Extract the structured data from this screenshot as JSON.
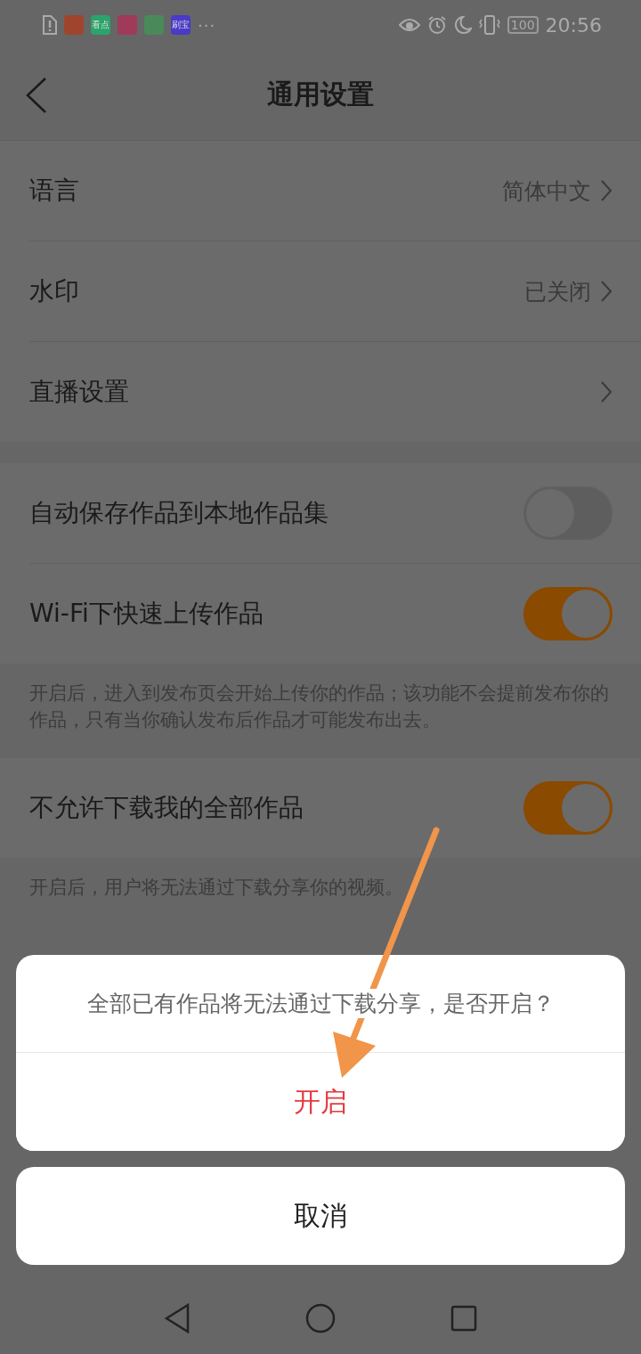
{
  "status_bar": {
    "app_icons": [
      {
        "kind": "warning"
      },
      {
        "kind": "red"
      },
      {
        "kind": "text",
        "label": "看点",
        "color": "#2aa46a"
      },
      {
        "kind": "pink"
      },
      {
        "kind": "green"
      },
      {
        "kind": "text",
        "label": "刷宝",
        "color": "#4a3ac8"
      }
    ],
    "more": "···",
    "battery": "100",
    "time": "20:56"
  },
  "header": {
    "title": "通用设置"
  },
  "sections": [
    {
      "rows": [
        {
          "kind": "link",
          "label": "语言",
          "value": "简体中文"
        },
        {
          "kind": "link",
          "label": "水印",
          "value": "已关闭"
        },
        {
          "kind": "link",
          "label": "直播设置"
        }
      ]
    },
    {
      "rows": [
        {
          "kind": "toggle",
          "label": "自动保存作品到本地作品集",
          "on": false
        },
        {
          "kind": "toggle",
          "label": "Wi-Fi下快速上传作品",
          "on": true
        }
      ],
      "note": "开启后，进入到发布页会开始上传你的作品；该功能不会提前发布你的作品，只有当你确认发布后作品才可能发布出去。"
    },
    {
      "rows": [
        {
          "kind": "toggle",
          "label": "不允许下载我的全部作品",
          "on": true
        }
      ],
      "note": "开启后，用户将无法通过下载分享你的视频。"
    }
  ],
  "dialog": {
    "message": "全部已有作品将无法通过下载分享，是否开启？",
    "confirm": "开启",
    "cancel": "取消"
  }
}
